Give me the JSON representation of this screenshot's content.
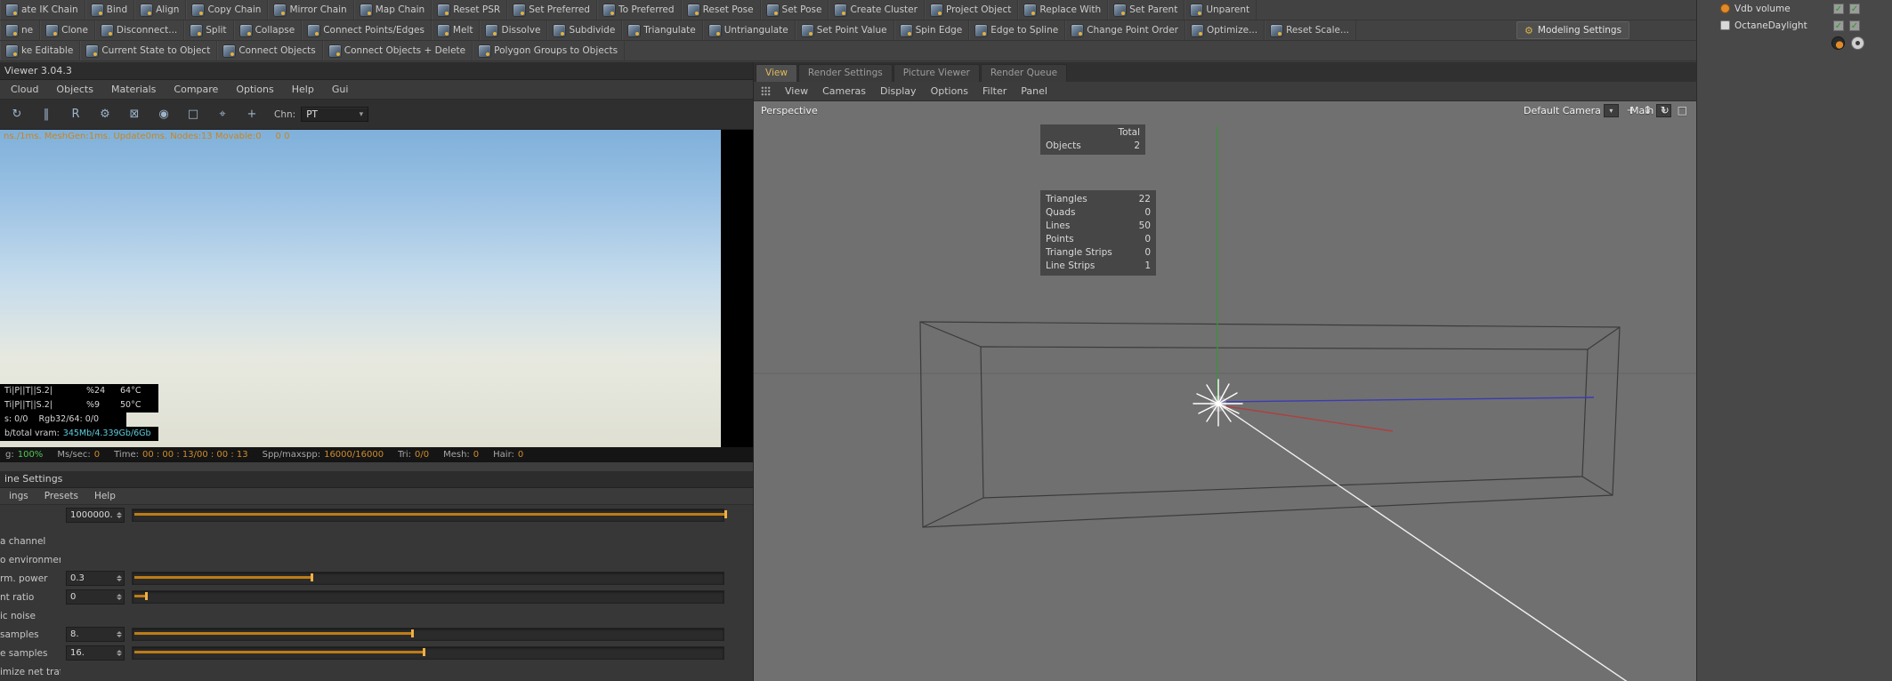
{
  "toolbar": {
    "row1": [
      "ate IK Chain",
      "Bind",
      "Align",
      "Copy Chain",
      "Mirror Chain",
      "Map Chain",
      "Reset PSR",
      "Set Preferred",
      "To Preferred",
      "Reset Pose",
      "Set Pose",
      "Create Cluster",
      "Project Object",
      "Replace With",
      "Set Parent",
      "Unparent"
    ],
    "row2": [
      "ne",
      "Clone",
      "Disconnect...",
      "Split",
      "Collapse",
      "Connect Points/Edges",
      "Melt",
      "Dissolve",
      "Subdivide",
      "Triangulate",
      "Untriangulate",
      "Set Point Value",
      "Spin Edge",
      "Edge to Spline",
      "Change Point Order",
      "Optimize...",
      "Reset Scale..."
    ],
    "modeling_settings_label": "Modeling Settings",
    "row3": [
      "ke Editable",
      "Current State to Object",
      "Connect Objects",
      "Connect Objects + Delete",
      "Polygon Groups to Objects"
    ]
  },
  "viewer": {
    "title": "Viewer 3.04.3",
    "menu": [
      "Cloud",
      "Objects",
      "Materials",
      "Compare",
      "Options",
      "Help",
      "Gui"
    ],
    "toolbar_icons": [
      {
        "name": "restart-render-icon",
        "glyph": "↻"
      },
      {
        "name": "pause-render-icon",
        "glyph": "‖"
      },
      {
        "name": "realtime-mode-icon",
        "glyph": "R"
      },
      {
        "name": "settings-gear-icon",
        "glyph": "⚙"
      },
      {
        "name": "lock-resolution-icon",
        "glyph": "⊠"
      },
      {
        "name": "focus-pick-icon",
        "glyph": "◉"
      },
      {
        "name": "render-region-icon",
        "glyph": "□"
      },
      {
        "name": "pick-material-icon",
        "glyph": "⌖"
      },
      {
        "name": "pick-object-icon",
        "glyph": "+"
      }
    ],
    "channel_label": "Chn:",
    "channel_value": "PT",
    "render_stats_line": "ns./1ms. MeshGen:1ms. Update0ms. Nodes:13 Movable:0     0 0",
    "overlay": {
      "gpu1": {
        "name": "Ti|P||T||S.2|",
        "load": "%24",
        "temp": "64°C"
      },
      "gpu2": {
        "name": "Ti|P||T||S.2|",
        "load": "%9",
        "temp": "50°C"
      },
      "row3_left": "s: 0/0",
      "row3_right": "Rgb32/64: 0/0",
      "vram_label": "b/total vram:",
      "vram_value": "345Mb/4.339Gb/6Gb"
    },
    "statusbar": [
      {
        "label": "g:",
        "value": "100%",
        "color": "#53c553"
      },
      {
        "label": "Ms/sec:",
        "value": "0",
        "color": "#cf8c2e"
      },
      {
        "label": "Time:",
        "value": "00 : 00 : 13/00 : 00 : 13",
        "color": "#cf8c2e"
      },
      {
        "label": "Spp/maxspp:",
        "value": "16000/16000",
        "color": "#cf8c2e"
      },
      {
        "label": "Tri:",
        "value": "0/0",
        "color": "#cf8c2e"
      },
      {
        "label": "Mesh:",
        "value": "0",
        "color": "#cf8c2e"
      },
      {
        "label": "Hair:",
        "value": "0",
        "color": "#cf8c2e"
      }
    ]
  },
  "engine": {
    "title": "ine Settings",
    "menu": [
      "ings",
      "Presets",
      "Help"
    ],
    "rows": [
      {
        "label": "",
        "value": "1000000.",
        "fill": "100%"
      },
      {
        "label": "a channel"
      },
      {
        "label": "o environment"
      },
      {
        "label": "rm. power",
        "value": "0.3",
        "fill": "30%"
      },
      {
        "label": "nt ratio",
        "value": "0",
        "fill": "2%"
      },
      {
        "label": "ic noise"
      },
      {
        "label": "samples",
        "value": "8.",
        "fill": "47%"
      },
      {
        "label": "e samples",
        "value": "16.",
        "fill": "49%"
      },
      {
        "label": "imize net traffic"
      }
    ]
  },
  "viewport": {
    "tabs": [
      "View",
      "Render Settings",
      "Picture Viewer",
      "Render Queue"
    ],
    "active_tab": "View",
    "menu": [
      "View",
      "Cameras",
      "Display",
      "Options",
      "Filter",
      "Panel"
    ],
    "nav_icons": [
      {
        "name": "pan-view-icon",
        "glyph": "+"
      },
      {
        "name": "dolly-view-icon",
        "glyph": "↕"
      },
      {
        "name": "rotate-view-icon",
        "glyph": "↻"
      },
      {
        "name": "toggle-view-icon",
        "glyph": "□"
      }
    ],
    "perspective_label": "Perspective",
    "default_camera_label": "Default Camera",
    "main_label": "Main",
    "hud": {
      "total_label": "Total",
      "objects_label": "Objects",
      "objects_value": "2",
      "stats": [
        {
          "label": "Triangles",
          "value": "22"
        },
        {
          "label": "Quads",
          "value": "0"
        },
        {
          "label": "Lines",
          "value": "50"
        },
        {
          "label": "Points",
          "value": "0"
        },
        {
          "label": "Triangle Strips",
          "value": "0"
        },
        {
          "label": "Line Strips",
          "value": "1"
        }
      ]
    }
  },
  "objects_panel": {
    "items": [
      {
        "name": "Vdb volume",
        "icon_bg": "#e08a28",
        "icon_radius": "50%"
      },
      {
        "name": "OctaneDaylight",
        "icon_bg": "#d8d8d8",
        "icon_radius": "2px"
      }
    ]
  }
}
